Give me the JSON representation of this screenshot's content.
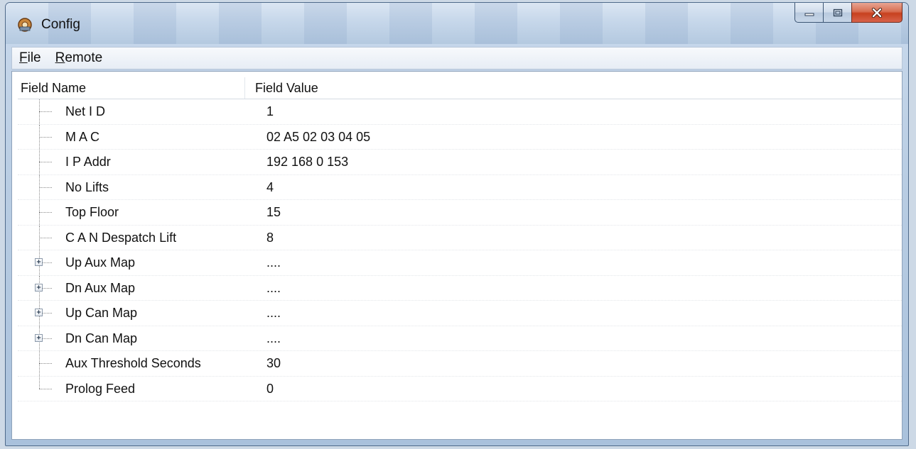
{
  "window": {
    "title": "Config",
    "app_icon": "app-gear-icon",
    "caption": {
      "minimize_icon": "minimize-icon",
      "maximize_icon": "maximize-icon",
      "close_icon": "close-icon"
    }
  },
  "menu": {
    "file": {
      "access": "F",
      "rest": "ile"
    },
    "remote": {
      "access": "R",
      "rest": "emote"
    }
  },
  "grid": {
    "headers": {
      "name": "Field Name",
      "value": "Field Value"
    },
    "rows": [
      {
        "name": "Net I D",
        "value": "1",
        "expandable": false
      },
      {
        "name": "M A C",
        "value": "02 A5 02 03 04 05",
        "expandable": false
      },
      {
        "name": "I P Addr",
        "value": "192 168 0 153",
        "expandable": false
      },
      {
        "name": "No Lifts",
        "value": "4",
        "expandable": false
      },
      {
        "name": "Top Floor",
        "value": "15",
        "expandable": false
      },
      {
        "name": "C A N Despatch Lift",
        "value": "8",
        "expandable": false
      },
      {
        "name": "Up Aux Map",
        "value": "....",
        "expandable": true
      },
      {
        "name": "Dn Aux Map",
        "value": "....",
        "expandable": true
      },
      {
        "name": "Up Can Map",
        "value": "....",
        "expandable": true
      },
      {
        "name": "Dn Can Map",
        "value": "....",
        "expandable": true
      },
      {
        "name": "Aux Threshold Seconds",
        "value": "30",
        "expandable": false
      },
      {
        "name": "Prolog Feed",
        "value": "0",
        "expandable": false
      }
    ],
    "expander_symbol": "+"
  },
  "colors": {
    "close_button": "#c7411f",
    "titlebar": "#c6d7ea",
    "grid_background": "#ffffff"
  }
}
